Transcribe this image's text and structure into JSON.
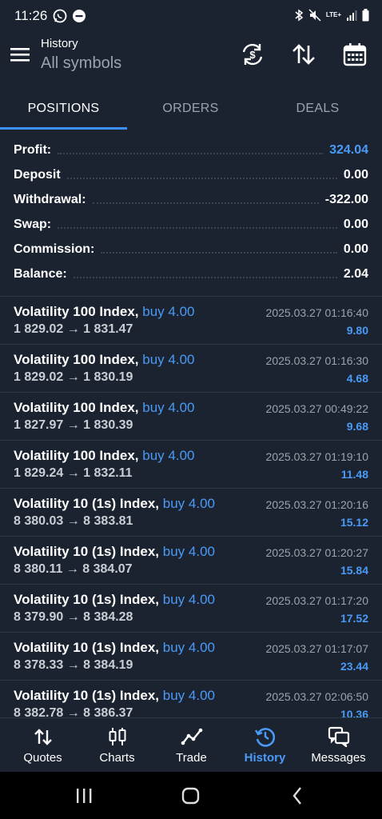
{
  "status_bar": {
    "time": "11:26",
    "network_label": "LTE+"
  },
  "app_bar": {
    "title_small": "History",
    "title_big": "All symbols"
  },
  "tabs": [
    {
      "label": "POSITIONS",
      "active": true
    },
    {
      "label": "ORDERS",
      "active": false
    },
    {
      "label": "DEALS",
      "active": false
    }
  ],
  "summary": [
    {
      "label": "Profit:",
      "value": "324.04",
      "highlight": true
    },
    {
      "label": "Deposit",
      "value": "0.00",
      "highlight": false
    },
    {
      "label": "Withdrawal:",
      "value": "-322.00",
      "highlight": false
    },
    {
      "label": "Swap:",
      "value": "0.00",
      "highlight": false
    },
    {
      "label": "Commission:",
      "value": "0.00",
      "highlight": false
    },
    {
      "label": "Balance:",
      "value": "2.04",
      "highlight": false
    }
  ],
  "deals": [
    {
      "symbol": "Volatility 100 Index,",
      "side": "buy 4.00",
      "prices": "1 829.02 → 1 831.47",
      "time": "2025.03.27 01:16:40",
      "profit": "9.80"
    },
    {
      "symbol": "Volatility 100 Index,",
      "side": "buy 4.00",
      "prices": "1 829.02 → 1 830.19",
      "time": "2025.03.27 01:16:30",
      "profit": "4.68"
    },
    {
      "symbol": "Volatility 100 Index,",
      "side": "buy 4.00",
      "prices": "1 827.97 → 1 830.39",
      "time": "2025.03.27 00:49:22",
      "profit": "9.68"
    },
    {
      "symbol": "Volatility 100 Index,",
      "side": "buy 4.00",
      "prices": "1 829.24 → 1 832.11",
      "time": "2025.03.27 01:19:10",
      "profit": "11.48"
    },
    {
      "symbol": "Volatility 10 (1s) Index,",
      "side": "buy 4.00",
      "prices": "8 380.03 → 8 383.81",
      "time": "2025.03.27 01:20:16",
      "profit": "15.12"
    },
    {
      "symbol": "Volatility 10 (1s) Index,",
      "side": "buy 4.00",
      "prices": "8 380.11 → 8 384.07",
      "time": "2025.03.27 01:20:27",
      "profit": "15.84"
    },
    {
      "symbol": "Volatility 10 (1s) Index,",
      "side": "buy 4.00",
      "prices": "8 379.90 → 8 384.28",
      "time": "2025.03.27 01:17:20",
      "profit": "17.52"
    },
    {
      "symbol": "Volatility 10 (1s) Index,",
      "side": "buy 4.00",
      "prices": "8 378.33 → 8 384.19",
      "time": "2025.03.27 01:17:07",
      "profit": "23.44"
    },
    {
      "symbol": "Volatility 10 (1s) Index,",
      "side": "buy 4.00",
      "prices": "8 382.78 → 8 386.37",
      "time": "2025.03.27 02:06:50",
      "profit": "10.36"
    }
  ],
  "bottom_nav": [
    {
      "label": "Quotes",
      "icon": "quotes-arrows-icon",
      "active": false
    },
    {
      "label": "Charts",
      "icon": "candlestick-icon",
      "active": false
    },
    {
      "label": "Trade",
      "icon": "trade-line-icon",
      "active": false
    },
    {
      "label": "History",
      "icon": "history-clock-icon",
      "active": true
    },
    {
      "label": "Messages",
      "icon": "messages-icon",
      "active": false
    }
  ],
  "colors": {
    "background": "#1b2330",
    "accent": "#4a9af7",
    "muted": "#9aa3ae",
    "divider": "#2c3542"
  }
}
